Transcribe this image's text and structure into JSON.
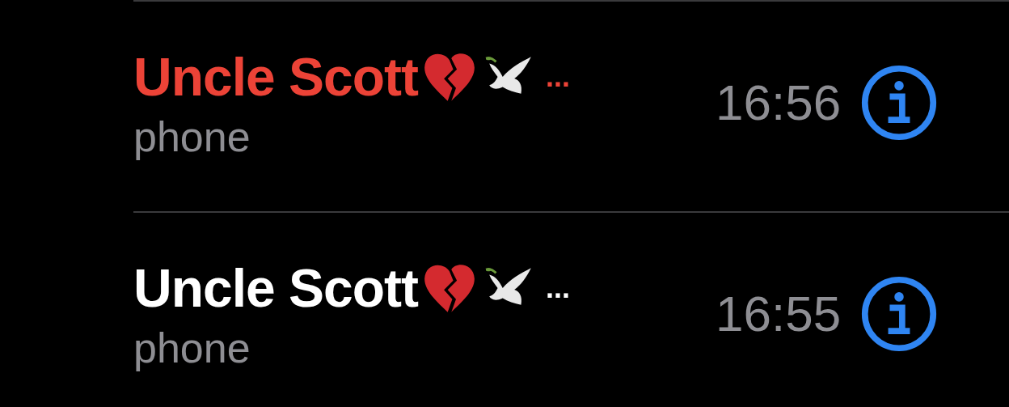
{
  "calls": [
    {
      "name": "Uncle Scott",
      "overflow": "...",
      "label": "phone",
      "time": "16:56",
      "missed": true
    },
    {
      "name": "Uncle Scott",
      "overflow": "...",
      "label": "phone",
      "time": "16:55",
      "missed": false
    }
  ]
}
